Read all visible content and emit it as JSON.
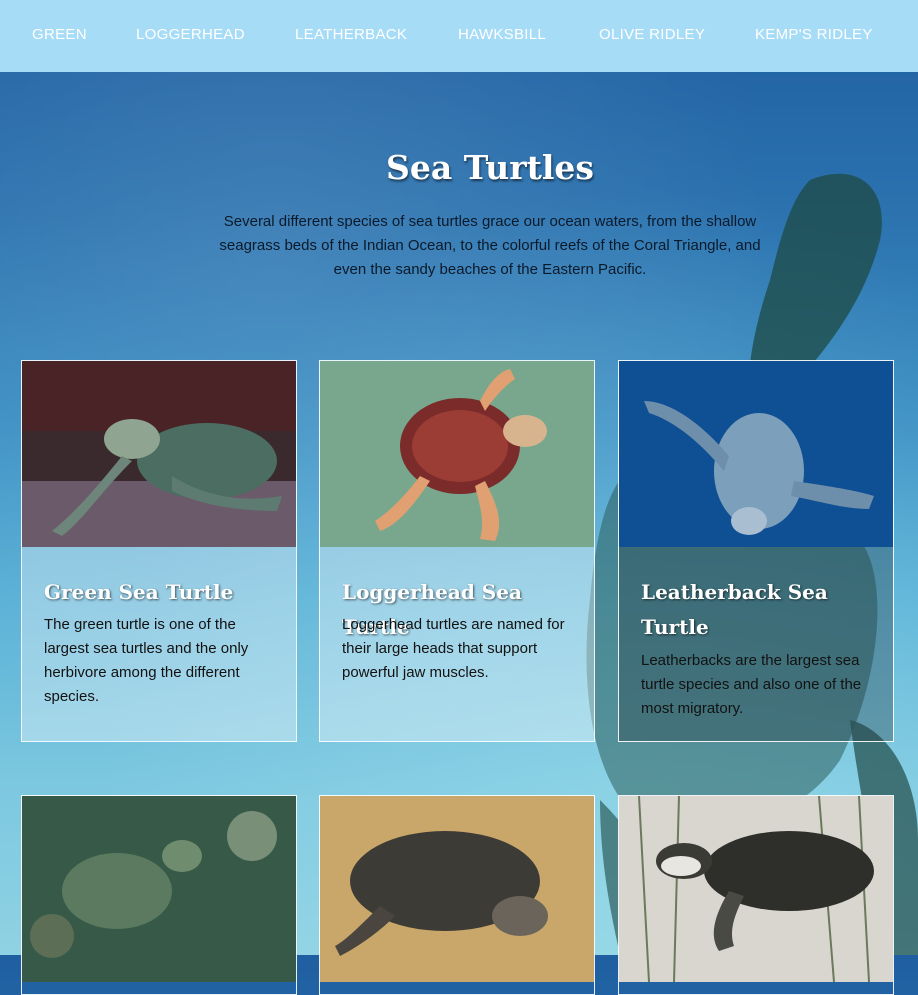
{
  "nav": {
    "items": [
      "GREEN",
      "LOGGERHEAD",
      "LEATHERBACK",
      "HAWKSBILL",
      "OLIVE RIDLEY",
      "KEMP'S RIDLEY"
    ]
  },
  "hero": {
    "title": "Sea Turtles",
    "intro": "Several different species of sea turtles grace our ocean waters, from the shallow seagrass beds of the Indian Ocean, to the colorful reefs of the Coral Triangle, and even the sandy beaches of the Eastern Pacific."
  },
  "cards": [
    {
      "title": "Green Sea Turtle",
      "text": "The green turtle is one of the largest sea turtles and the only herbivore among the different species."
    },
    {
      "title": "Loggerhead Sea Turtle",
      "text": "Loggerhead turtles are named for their large heads that support powerful jaw muscles."
    },
    {
      "title": "Leatherback Sea Turtle",
      "text": "Leatherbacks are the largest sea turtle species and also one of the most migratory."
    }
  ],
  "colors": {
    "nav_bg": "#a7dcf7",
    "nav_text": "#ffffff",
    "ocean_deep": "#1f5fa1",
    "ocean_shallow": "#8fd2e3"
  },
  "icons": {
    "photos": [
      "green-turtle-photo",
      "loggerhead-turtle-photo",
      "leatherback-turtle-photo",
      "hawksbill-turtle-photo",
      "olive-ridley-turtle-photo",
      "kemps-ridley-turtle-photo"
    ]
  }
}
